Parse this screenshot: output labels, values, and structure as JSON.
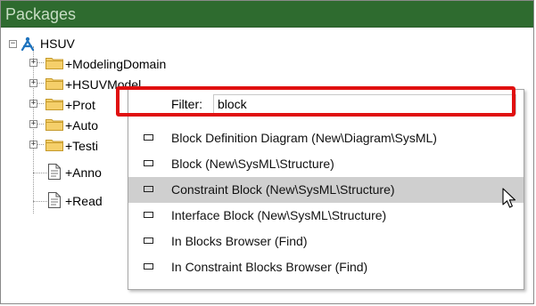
{
  "panel": {
    "title": "Packages"
  },
  "tree": {
    "root": {
      "label": "HSUV",
      "expander": "−"
    },
    "children": [
      {
        "label": "+ModelingDomain",
        "kind": "folder",
        "expander": "+"
      },
      {
        "label": "+HSUVModel",
        "kind": "folder",
        "expander": "+"
      },
      {
        "label": "+Prot",
        "kind": "folder",
        "expander": "+"
      },
      {
        "label": "+Auto",
        "kind": "folder",
        "expander": "+"
      },
      {
        "label": "+Testi",
        "kind": "folder",
        "expander": "+"
      },
      {
        "label": "+Anno",
        "kind": "document"
      },
      {
        "label": "+Read",
        "kind": "document"
      }
    ]
  },
  "popup": {
    "filter_label": "Filter:",
    "filter_value": "block",
    "items": [
      {
        "label": "Block Definition Diagram (New\\Diagram\\SysML)"
      },
      {
        "label": "Block (New\\SysML\\Structure)"
      },
      {
        "label": "Constraint Block (New\\SysML\\Structure)",
        "hovered": true
      },
      {
        "label": "Interface Block (New\\SysML\\Structure)"
      },
      {
        "label": "In Blocks Browser (Find)"
      },
      {
        "label": "In Constraint Blocks Browser (Find)"
      }
    ]
  },
  "colors": {
    "header_bg": "#2e6b2f",
    "header_text": "#c7ddc4",
    "highlight_border": "#e01010",
    "hover_bg": "#cfcfcf",
    "root_icon": "#1e73be",
    "folder_fill": "#f5cf6a"
  }
}
